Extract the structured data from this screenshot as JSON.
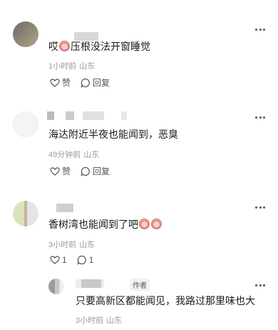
{
  "comments": [
    {
      "text_before": "哎",
      "text_after": "压根没法开窗睡觉",
      "time": "1小时前",
      "location": "山东",
      "like_label": "赞",
      "reply_label": "回复"
    },
    {
      "text": "海达附近半夜也能闻到，恶臭",
      "time": "49分钟前",
      "location": "山东",
      "like_label": "赞",
      "reply_label": "回复"
    },
    {
      "text": "香树湾也能闻到了吧",
      "time": "3小时前",
      "location": "山东",
      "like_count": "1",
      "reply_count": "1"
    }
  ],
  "reply": {
    "badge": "作者",
    "text": "只要高新区都能闻见，我路过那里味也大",
    "time": "3小时前",
    "location": "山东"
  },
  "icons": [
    "like-icon",
    "reply-icon",
    "more-icon",
    "emoji-icon"
  ]
}
